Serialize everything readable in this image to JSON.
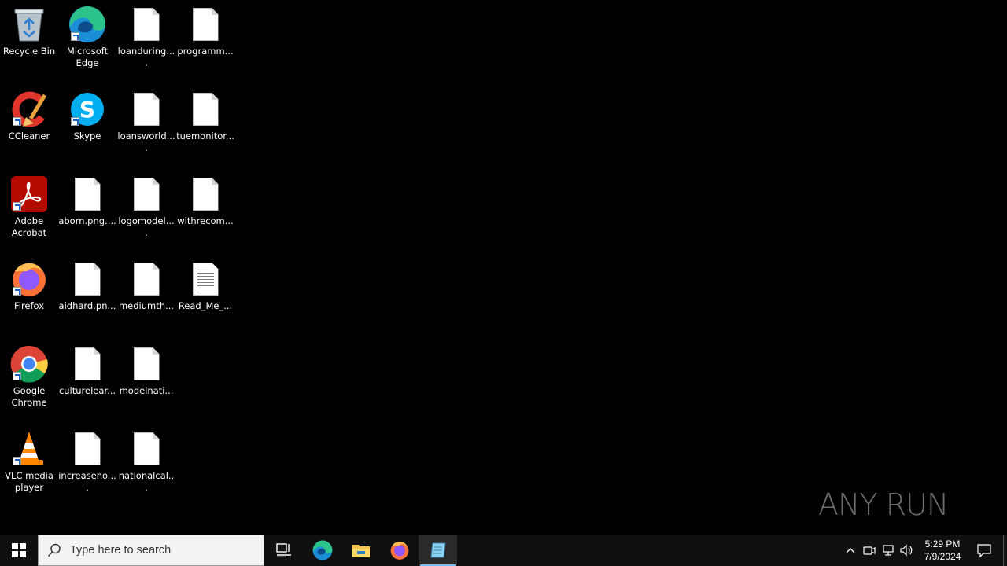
{
  "desktop": {
    "icons": [
      {
        "label": "Recycle Bin",
        "icon": "recycle-bin-icon"
      },
      {
        "label": "Microsoft Edge",
        "icon": "edge-icon"
      },
      {
        "label": "loanduring....",
        "icon": "file-icon"
      },
      {
        "label": "programm...",
        "icon": "file-icon"
      },
      {
        "label": "CCleaner",
        "icon": "ccleaner-icon"
      },
      {
        "label": "Skype",
        "icon": "skype-icon"
      },
      {
        "label": "loansworld....",
        "icon": "file-icon"
      },
      {
        "label": "tuemonitor...",
        "icon": "file-icon"
      },
      {
        "label": "Adobe Acrobat",
        "icon": "acrobat-icon"
      },
      {
        "label": "aborn.png....",
        "icon": "file-icon"
      },
      {
        "label": "logomodel....",
        "icon": "file-icon"
      },
      {
        "label": "withrecom...",
        "icon": "file-icon"
      },
      {
        "label": "Firefox",
        "icon": "firefox-icon"
      },
      {
        "label": "aidhard.pn...",
        "icon": "file-icon"
      },
      {
        "label": "mediumth...",
        "icon": "file-icon"
      },
      {
        "label": "Read_Me_...",
        "icon": "text-file-icon"
      },
      {
        "label": "Google Chrome",
        "icon": "chrome-icon"
      },
      {
        "label": "culturelear...",
        "icon": "file-icon"
      },
      {
        "label": "modelnati...",
        "icon": "file-icon"
      },
      {
        "label": "VLC media player",
        "icon": "vlc-icon"
      },
      {
        "label": "increaseno....",
        "icon": "file-icon"
      },
      {
        "label": "nationalcal...",
        "icon": "file-icon"
      }
    ]
  },
  "watermark": {
    "text": "ANY RUN"
  },
  "taskbar": {
    "search_placeholder": "Type here to search",
    "pinned": [
      "task-view-icon",
      "edge-icon",
      "file-explorer-icon",
      "firefox-icon",
      "notepad-icon"
    ],
    "clock_time": "5:29 PM",
    "clock_date": "7/9/2024"
  },
  "colors": {
    "taskbar": "#101010",
    "accent": "#76b9ed",
    "search_bg": "#f3f3f3"
  }
}
